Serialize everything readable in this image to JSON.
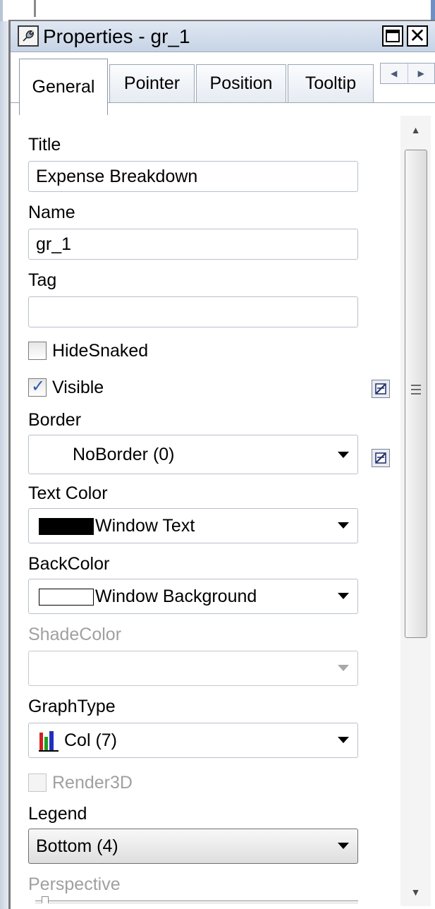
{
  "window": {
    "title": "Properties - gr_1"
  },
  "tabs": [
    {
      "label": "General",
      "active": true
    },
    {
      "label": "Pointer",
      "active": false
    },
    {
      "label": "Position",
      "active": false
    },
    {
      "label": "Tooltip",
      "active": false
    }
  ],
  "fields": {
    "title": {
      "label": "Title",
      "value": "Expense Breakdown"
    },
    "name": {
      "label": "Name",
      "value": "gr_1"
    },
    "tag": {
      "label": "Tag",
      "value": ""
    },
    "hide_snaked": {
      "label": "HideSnaked",
      "checked": false
    },
    "visible": {
      "label": "Visible",
      "checked": true
    },
    "border": {
      "label": "Border",
      "value": "NoBorder (0)"
    },
    "text_color": {
      "label": "Text Color",
      "value": "Window Text",
      "swatch": "#000000"
    },
    "back_color": {
      "label": "BackColor",
      "value": "Window Background",
      "swatch": "#ffffff"
    },
    "shade_color": {
      "label": "ShadeColor",
      "value": "",
      "enabled": false
    },
    "graph_type": {
      "label": "GraphType",
      "value": "Col (7)",
      "icon": "column-chart-icon"
    },
    "render3d": {
      "label": "Render3D",
      "checked": false,
      "enabled": false
    },
    "legend": {
      "label": "Legend",
      "value": "Bottom (4)"
    },
    "perspective": {
      "label": "Perspective",
      "enabled": false
    }
  },
  "colors": {
    "titlebar": "#c7d4e6",
    "check_accent": "#2f5ba8",
    "disabled_text": "#a0a0a0"
  }
}
